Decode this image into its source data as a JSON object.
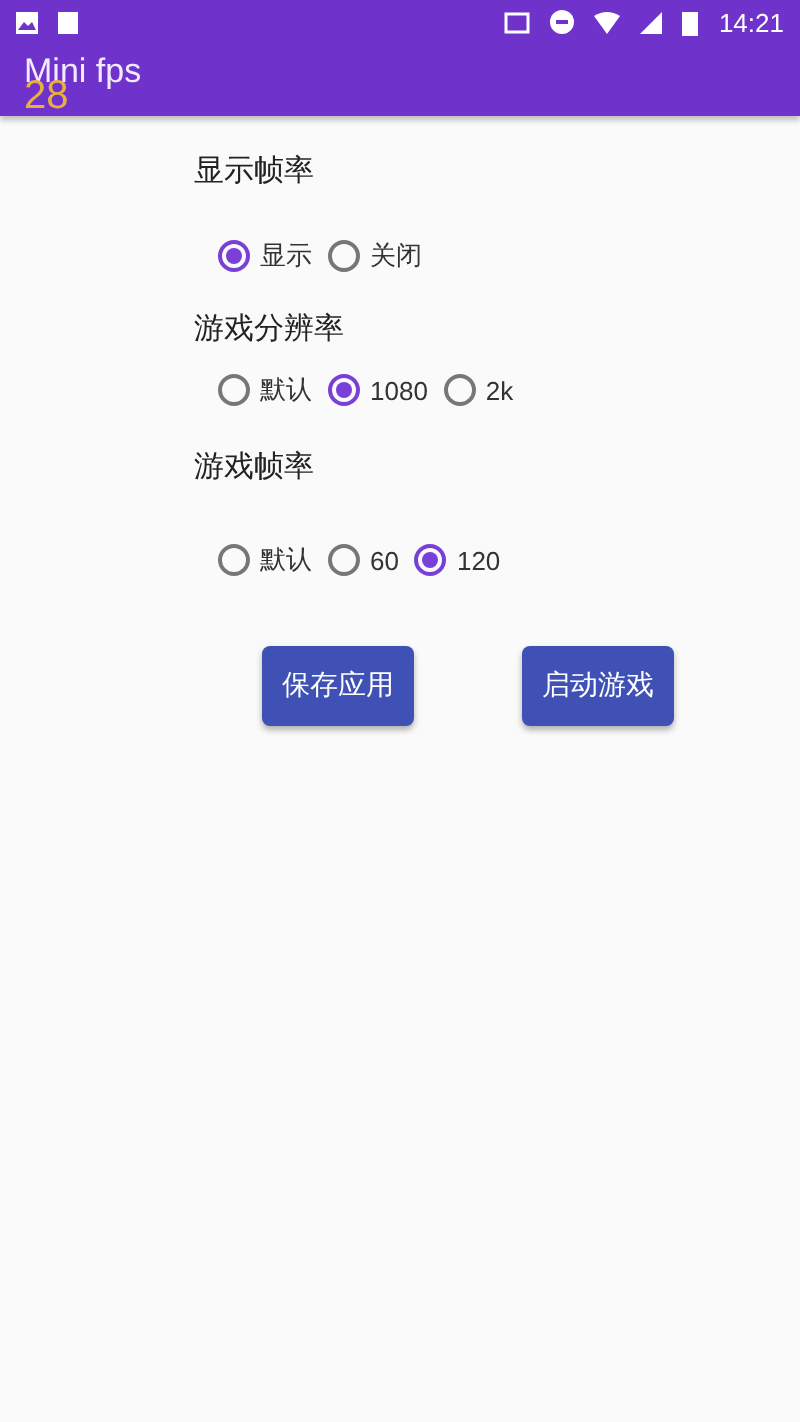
{
  "status_bar": {
    "time": "14:21"
  },
  "app_bar": {
    "title": "Mini fps",
    "overlay_fps": "28"
  },
  "groups": [
    {
      "title": "显示帧率",
      "options": [
        {
          "label": "显示",
          "selected": true
        },
        {
          "label": "关闭",
          "selected": false
        }
      ]
    },
    {
      "title": "游戏分辨率",
      "options": [
        {
          "label": "默认",
          "selected": false
        },
        {
          "label": "1080",
          "selected": true
        },
        {
          "label": "2k",
          "selected": false
        }
      ]
    },
    {
      "title": "游戏帧率",
      "options": [
        {
          "label": "默认",
          "selected": false
        },
        {
          "label": "60",
          "selected": false
        },
        {
          "label": "120",
          "selected": true
        }
      ]
    }
  ],
  "buttons": [
    "保存应用",
    "启动游戏"
  ]
}
